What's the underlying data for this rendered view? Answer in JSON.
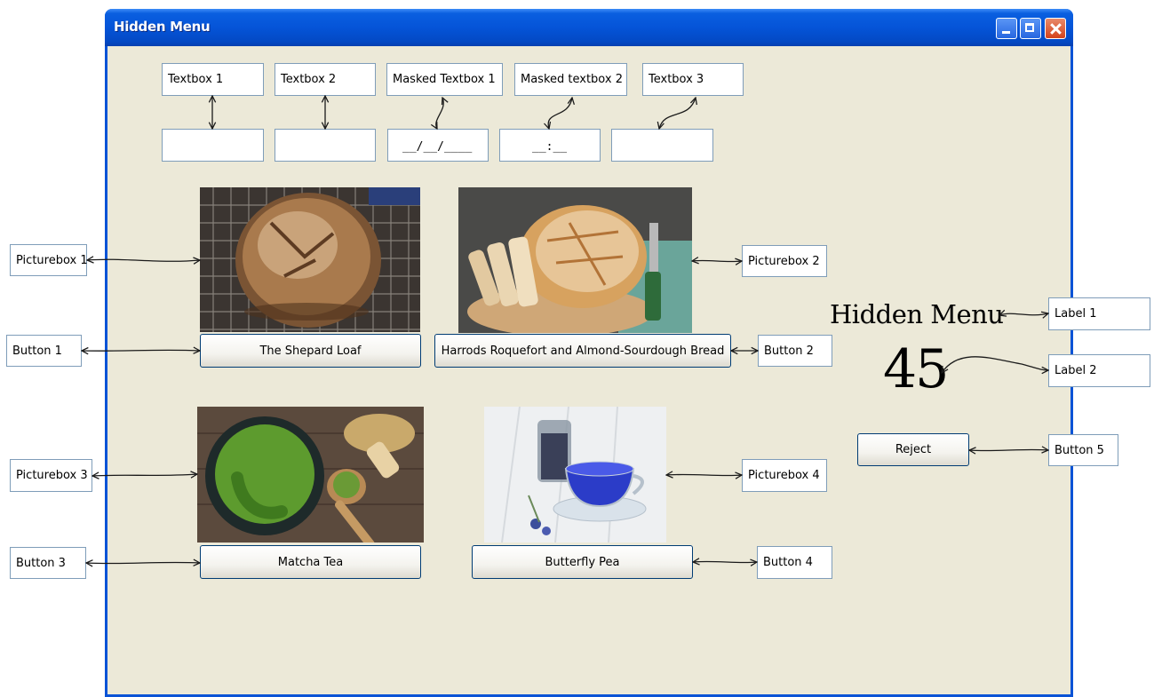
{
  "window": {
    "title": "Hidden Menu"
  },
  "textboxes": [
    {
      "label": "Textbox 1",
      "value": ""
    },
    {
      "label": "Textbox 2",
      "value": ""
    },
    {
      "label": "Masked Textbox 1",
      "value": "__/__/____"
    },
    {
      "label": "Masked textbox 2",
      "value": "__:__"
    },
    {
      "label": "Textbox 3",
      "value": ""
    }
  ],
  "side_labels": {
    "picturebox1": "Picturebox 1",
    "picturebox2": "Picturebox 2",
    "picturebox3": "Picturebox 3",
    "picturebox4": "Picturebox 4",
    "button1": "Button 1",
    "button2": "Button 2",
    "button3": "Button 3",
    "button4": "Button 4",
    "button5": "Button 5",
    "label1": "Label 1",
    "label2": "Label 2"
  },
  "buttons": {
    "b1": "The Shepard Loaf",
    "b2": "Harrods Roquefort and Almond-Sourdough Bread",
    "b3": "Matcha Tea",
    "b4": "Butterfly Pea",
    "b5": "Reject"
  },
  "labels": {
    "title": "Hidden Menu",
    "count": "45"
  },
  "colors": {
    "titlebar": "#0554d8",
    "form_bg": "#ece9d8",
    "button_border": "#003c74"
  }
}
